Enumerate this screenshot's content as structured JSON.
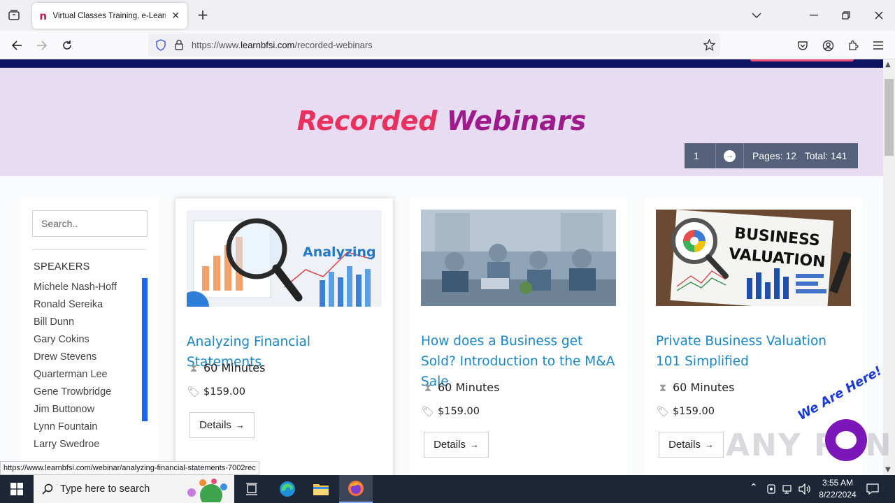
{
  "browser": {
    "tab_title": "Virtual Classes Training, e-Learn",
    "favicon_letter": "n",
    "url_prefix": "https://www.",
    "url_domain": "learnbfsi.com",
    "url_path": "/recorded-webinars"
  },
  "hero": {
    "title_word1": "Recorded",
    "title_word2": "Webinars"
  },
  "pager": {
    "current_page": "1",
    "pages_label": "Pages: 12",
    "total_label": "Total: 141"
  },
  "sidebar": {
    "search_placeholder": "Search..",
    "speakers_heading": "SPEAKERS",
    "speakers": [
      "Michele Nash-Hoff",
      "Ronald Sereika",
      "Bill Dunn",
      "Gary Cokins",
      "Drew Stevens",
      "Quarterman Lee",
      "Gene Trowbridge",
      "Jim Buttonow",
      "Lynn Fountain",
      "Larry Swedroe"
    ]
  },
  "cards": [
    {
      "title": "Analyzing Financial Statements",
      "image_label": "Analyzing",
      "duration": "60 Minutes",
      "price": "$159.00",
      "button": "Details"
    },
    {
      "title": "How does a Business get Sold? Introduction to the M&A Sale",
      "duration": "60 Minutes",
      "price": "$159.00",
      "button": "Details"
    },
    {
      "title": "Private Business Valuation 101 Simplified",
      "image_label_1": "BUSINESS",
      "image_label_2": "VALUATION",
      "duration": "60 Minutes",
      "price": "$159.00",
      "button": "Details"
    }
  ],
  "status_link": "https://www.learnbfsi.com/webinar/analyzing-financial-statements-7002rec",
  "chat": {
    "label": "We Are Here!"
  },
  "watermark": "ANY RUN",
  "taskbar": {
    "search_placeholder": "Type here to search",
    "time": "3:55 AM",
    "date": "8/22/2024"
  },
  "colors": {
    "hero_bg": "#e8dcf3",
    "title_pink": "#e8315f",
    "title_purple": "#9e1b8d",
    "link_blue": "#1a86c6",
    "nav_dark": "#0c1463",
    "pager_bg": "#55607a"
  }
}
